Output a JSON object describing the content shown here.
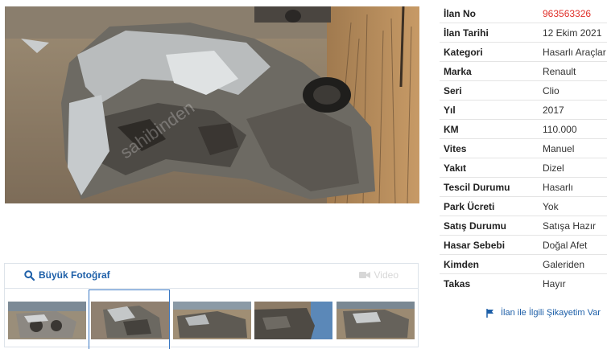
{
  "gallery": {
    "big_photo_label": "Büyük Fotoğraf",
    "video_label": "Video",
    "watermark": "sahibinden",
    "thumbnails": [
      {
        "name": "thumb-1",
        "active": false
      },
      {
        "name": "thumb-2",
        "active": true
      },
      {
        "name": "thumb-3",
        "active": false
      },
      {
        "name": "thumb-4",
        "active": false
      },
      {
        "name": "thumb-5",
        "active": false
      }
    ],
    "icons": {
      "big_photo": "search-icon",
      "video": "video-camera-icon"
    }
  },
  "listing": {
    "rows": [
      {
        "key": "İlan No",
        "value": "963563326",
        "highlight": true
      },
      {
        "key": "İlan Tarihi",
        "value": "12 Ekim 2021"
      },
      {
        "key": "Kategori",
        "value": "Hasarlı Araçlar"
      },
      {
        "key": "Marka",
        "value": "Renault"
      },
      {
        "key": "Seri",
        "value": "Clio"
      },
      {
        "key": "Yıl",
        "value": "2017"
      },
      {
        "key": "KM",
        "value": "110.000"
      },
      {
        "key": "Vites",
        "value": "Manuel"
      },
      {
        "key": "Yakıt",
        "value": "Dizel"
      },
      {
        "key": "Tescil Durumu",
        "value": "Hasarlı"
      },
      {
        "key": "Park Ücreti",
        "value": "Yok"
      },
      {
        "key": "Satış Durumu",
        "value": "Satışa Hazır"
      },
      {
        "key": "Hasar Sebebi",
        "value": "Doğal Afet"
      },
      {
        "key": "Kimden",
        "value": "Galeriden"
      },
      {
        "key": "Takas",
        "value": "Hayır"
      }
    ],
    "complaint_label": "İlan ile İlgili Şikayetim Var",
    "complaint_icon": "flag-icon"
  },
  "colors": {
    "accent": "#1d5fa8",
    "listing_no": "#e0312b"
  }
}
